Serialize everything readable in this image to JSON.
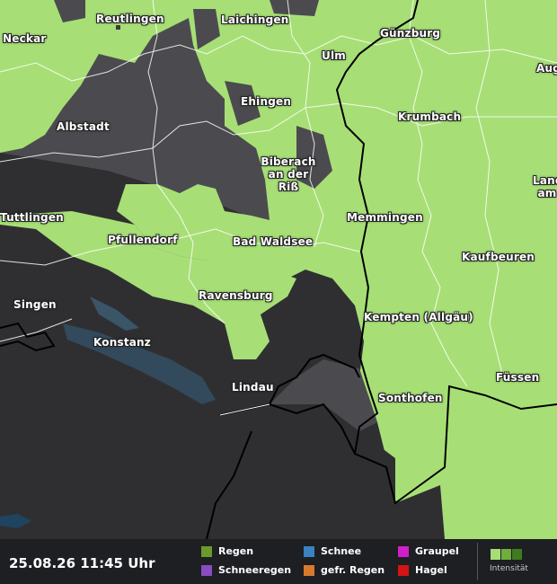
{
  "map": {
    "cities": [
      {
        "id": "reutlingen",
        "name": "Reutlingen"
      },
      {
        "id": "laichingen",
        "name": "Laichingen"
      },
      {
        "id": "guenzburg",
        "name": "Günzburg"
      },
      {
        "id": "neckar",
        "name": "Neckar"
      },
      {
        "id": "ulm",
        "name": "Ulm"
      },
      {
        "id": "augsburg",
        "name": "Aug"
      },
      {
        "id": "ehingen",
        "name": "Ehingen"
      },
      {
        "id": "krumbach",
        "name": "Krumbach"
      },
      {
        "id": "albstadt",
        "name": "Albstadt"
      },
      {
        "id": "biberach",
        "name": "Biberach an der Riß"
      },
      {
        "id": "landsberg",
        "name": "Land am"
      },
      {
        "id": "tuttlingen",
        "name": "Tuttlingen"
      },
      {
        "id": "memmingen",
        "name": "Memmingen"
      },
      {
        "id": "pfullendorf",
        "name": "Pfullendorf"
      },
      {
        "id": "badwaldsee",
        "name": "Bad Waldsee"
      },
      {
        "id": "kaufbeuren",
        "name": "Kaufbeuren"
      },
      {
        "id": "singen",
        "name": "Singen"
      },
      {
        "id": "ravensburg",
        "name": "Ravensburg"
      },
      {
        "id": "kempten",
        "name": "Kempten (Allgäu)"
      },
      {
        "id": "konstanz",
        "name": "Konstanz"
      },
      {
        "id": "fuessen",
        "name": "Füssen"
      },
      {
        "id": "lindau",
        "name": "Lindau"
      },
      {
        "id": "sonthofen",
        "name": "Sonthofen"
      }
    ]
  },
  "footer": {
    "timestamp": "25.08.26 11:45 Uhr",
    "legend": [
      {
        "id": "regen",
        "label": "Regen",
        "color": "#6a9a2a"
      },
      {
        "id": "schnee",
        "label": "Schnee",
        "color": "#3a82c0"
      },
      {
        "id": "graupel",
        "label": "Graupel",
        "color": "#d21ec8"
      },
      {
        "id": "schneeregen",
        "label": "Schneeregen",
        "color": "#8a4cc0"
      },
      {
        "id": "gefr-regen",
        "label": "gefr. Regen",
        "color": "#d87a2e"
      },
      {
        "id": "hagel",
        "label": "Hagel",
        "color": "#d41414"
      }
    ],
    "intensity_label": "Intensität",
    "intensity_colors": [
      "#a8dc78",
      "#6fae3c",
      "#3f7a1e"
    ]
  },
  "colors": {
    "rain_green": "#a7df76",
    "land_dark": "#4b4b4f",
    "mountain_dark": "#2f2f32",
    "lake": "#324a5c",
    "border": "#ffffff",
    "country_border": "#000000"
  }
}
